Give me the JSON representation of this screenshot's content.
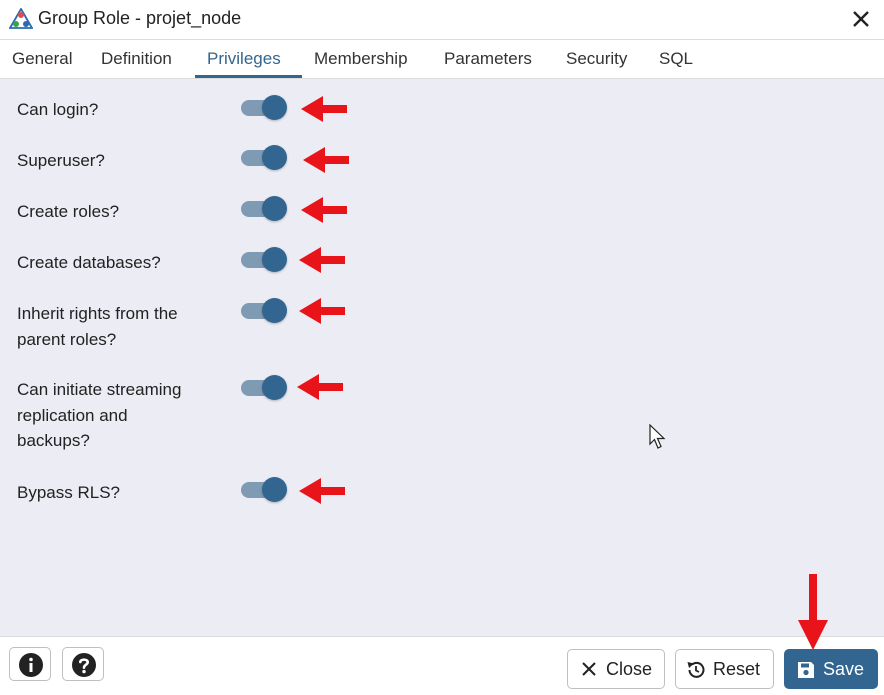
{
  "window": {
    "title": "Group Role - projet_node",
    "app_icon": "pgadmin-triangle-icon",
    "close_icon": "close-icon"
  },
  "tabs": [
    {
      "label": "General",
      "active": false
    },
    {
      "label": "Definition",
      "active": false
    },
    {
      "label": "Privileges",
      "active": true
    },
    {
      "label": "Membership",
      "active": false
    },
    {
      "label": "Parameters",
      "active": false
    },
    {
      "label": "Security",
      "active": false
    },
    {
      "label": "SQL",
      "active": false
    }
  ],
  "privileges": [
    {
      "label": "Can login?",
      "enabled": true
    },
    {
      "label": "Superuser?",
      "enabled": true
    },
    {
      "label": "Create roles?",
      "enabled": true
    },
    {
      "label": "Create databases?",
      "enabled": true
    },
    {
      "label": "Inherit rights from the parent roles?",
      "enabled": true
    },
    {
      "label": "Can initiate streaming replication and backups?",
      "enabled": true
    },
    {
      "label": "Bypass RLS?",
      "enabled": true
    }
  ],
  "footer": {
    "info_icon": "info-icon",
    "help_icon": "help-icon",
    "close_label": "Close",
    "reset_label": "Reset",
    "save_label": "Save"
  },
  "colors": {
    "accent": "#326690",
    "toggle_track": "#7f9ab3",
    "annotation_arrow": "#e8141a",
    "panel_background": "#ebecf4"
  }
}
